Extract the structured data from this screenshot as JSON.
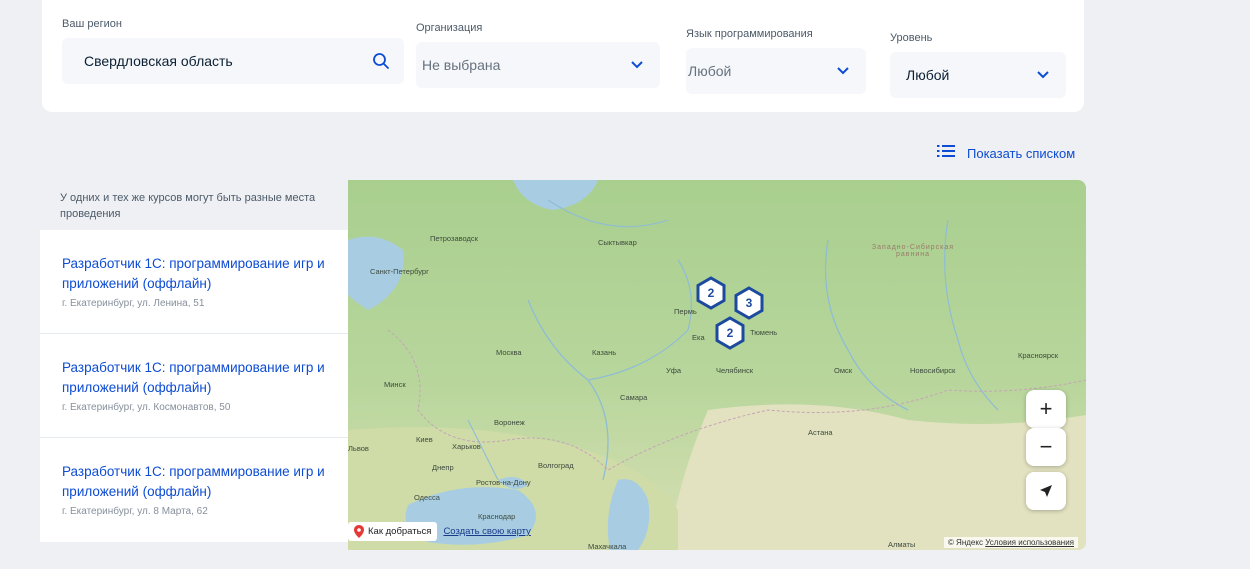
{
  "filters": {
    "region": {
      "label": "Ваш регион",
      "value": "Свердловская область"
    },
    "organization": {
      "label": "Организация",
      "value": "Не выбрана"
    },
    "language": {
      "label": "Язык программирования",
      "value": "Любой"
    },
    "level": {
      "label": "Уровень",
      "value": "Любой"
    }
  },
  "show_list_label": "Показать списком",
  "hint": "У одних и тех же курсов могут быть разные места проведения",
  "courses": [
    {
      "title": "Разработчик 1С: программирование игр и приложений (оффлайн)",
      "address": "г. Екатеринбург, ул. Ленина, 51"
    },
    {
      "title": "Разработчик 1С: программирование игр и приложений (оффлайн)",
      "address": "г. Екатеринбург, ул. Космонавтов, 50"
    },
    {
      "title": "Разработчик 1С: программирование игр и приложений (оффлайн)",
      "address": "г. Екатеринбург, ул. 8 Марта, 62"
    }
  ],
  "map": {
    "cities": {
      "petrozavodsk": "Петрозаводск",
      "syktyvkar": "Сыктывкар",
      "spb": "Санкт-Петербург",
      "perm": "Пермь",
      "tyumen": "Тюмень",
      "ekb": "Ека",
      "moscow": "Москва",
      "kazan": "Казань",
      "ufa": "Уфа",
      "chelyabinsk": "Челябинск",
      "omsk": "Омск",
      "novosibirsk": "Новосибирск",
      "krasnoyarsk": "Красноярск",
      "minsk": "Минск",
      "samara": "Самара",
      "voronezh": "Воронеж",
      "kyiv": "Киев",
      "kharkiv": "Харьков",
      "lviv": "Львов",
      "dnipro": "Днепр",
      "volgograd": "Волгоград",
      "rostov": "Ростов-на-Дону",
      "odesa": "Одесса",
      "krasnodar": "Краснодар",
      "astana": "Астана",
      "almaty": "Алматы",
      "makhachkala": "Махачкала",
      "west_siberian": "Западно-Сибирская равнина"
    },
    "clusters": [
      {
        "count": "2"
      },
      {
        "count": "3"
      },
      {
        "count": "2"
      }
    ],
    "zoom_in": "+",
    "zoom_out": "−",
    "route_label": "Как добраться",
    "create_map_label": "Создать свою карту",
    "copyright_prefix": "© Яндекс",
    "terms_label": "Условия использования"
  },
  "colors": {
    "accent": "#0d4cd3",
    "cluster": "#1c4a9e"
  }
}
